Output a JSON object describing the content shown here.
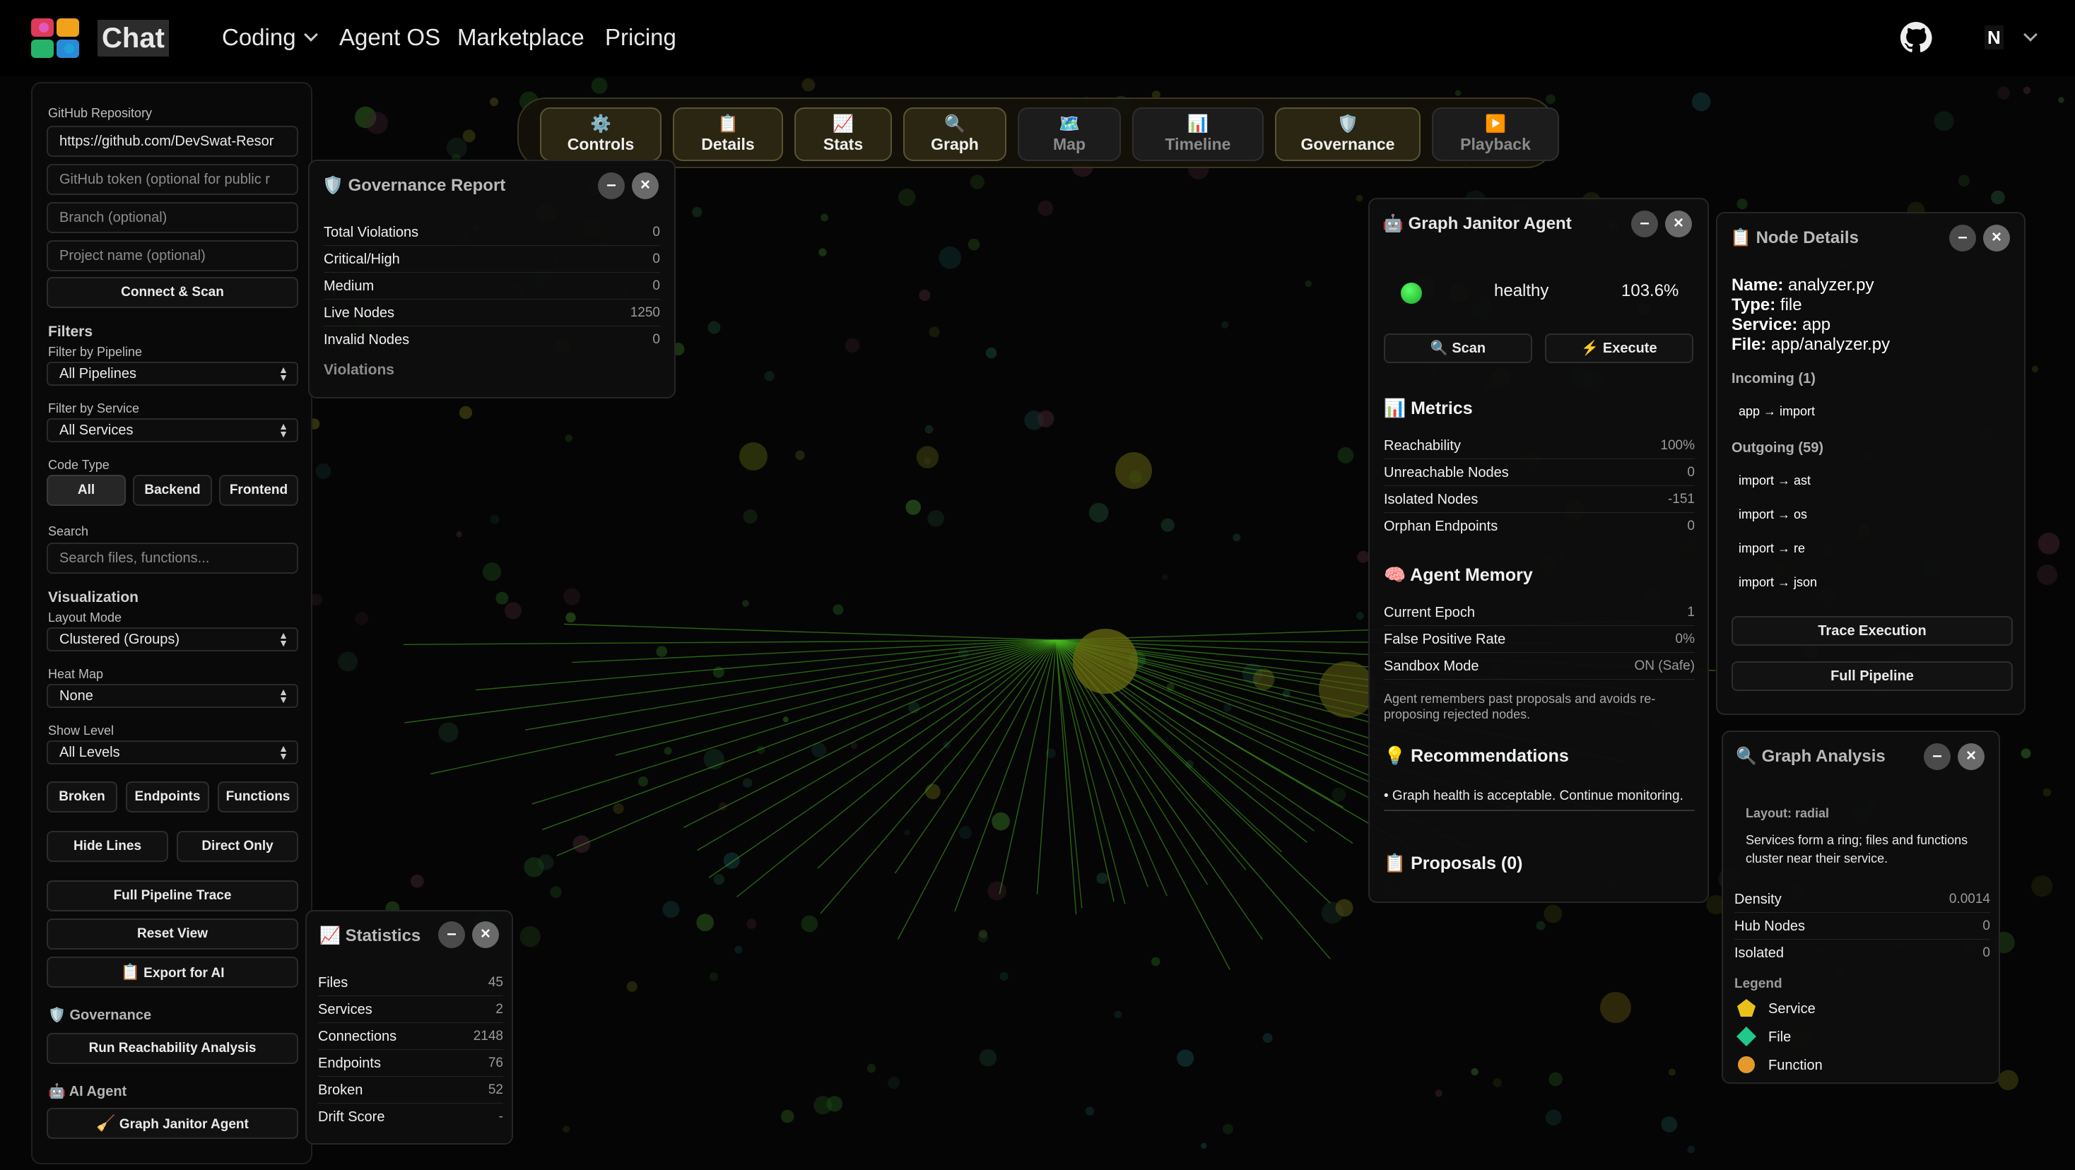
{
  "nav": {
    "app_title": "Chat",
    "links": [
      "Coding",
      "Agent OS",
      "Marketplace",
      "Pricing"
    ],
    "user_initial": "N"
  },
  "sidebar": {
    "repo_label": "GitHub Repository",
    "repo_value": "https://github.com/DevSwat-Resor",
    "token_placeholder": "GitHub token (optional for public r",
    "branch_placeholder": "Branch (optional)",
    "project_placeholder": "Project name (optional)",
    "connect_button": "Connect & Scan",
    "filters_heading": "Filters",
    "pipeline_label": "Filter by Pipeline",
    "pipeline_value": "All Pipelines",
    "service_label": "Filter by Service",
    "service_value": "All Services",
    "code_type_label": "Code Type",
    "code_types": [
      "All",
      "Backend",
      "Frontend"
    ],
    "search_label": "Search",
    "search_placeholder": "Search files, functions...",
    "viz_heading": "Visualization",
    "layout_label": "Layout Mode",
    "layout_value": "Clustered (Groups)",
    "heatmap_label": "Heat Map",
    "heatmap_value": "None",
    "level_label": "Show Level",
    "level_value": "All Levels",
    "toggles": [
      "Broken",
      "Endpoints",
      "Functions"
    ],
    "line_buttons": [
      "Hide Lines",
      "Direct Only"
    ],
    "full_trace": "Full Pipeline Trace",
    "reset_view": "Reset View",
    "export_ai": "Export for AI",
    "governance_heading": "Governance",
    "reachability_button": "Run Reachability Analysis",
    "ai_agent_heading": "AI Agent",
    "janitor_button": "Graph Janitor Agent"
  },
  "toolbar": {
    "buttons": [
      {
        "label": "Controls",
        "icon": "gear-icon"
      },
      {
        "label": "Details",
        "icon": "clipboard-icon"
      },
      {
        "label": "Stats",
        "icon": "chart-icon"
      },
      {
        "label": "Graph",
        "icon": "magnifier-icon"
      },
      {
        "label": "Map",
        "icon": "map-icon"
      },
      {
        "label": "Timeline",
        "icon": "bar-chart-icon"
      },
      {
        "label": "Governance",
        "icon": "shield-icon"
      },
      {
        "label": "Playback",
        "icon": "play-icon"
      }
    ]
  },
  "governance": {
    "title": "Governance Report",
    "rows": [
      {
        "label": "Total Violations",
        "value": "0"
      },
      {
        "label": "Critical/High",
        "value": "0"
      },
      {
        "label": "Medium",
        "value": "0"
      },
      {
        "label": "Live Nodes",
        "value": "1250"
      },
      {
        "label": "Invalid Nodes",
        "value": "0"
      }
    ],
    "violations_label": "Violations"
  },
  "statistics": {
    "title": "Statistics",
    "rows": [
      {
        "label": "Files",
        "value": "45"
      },
      {
        "label": "Services",
        "value": "2"
      },
      {
        "label": "Connections",
        "value": "2148"
      },
      {
        "label": "Endpoints",
        "value": "76"
      },
      {
        "label": "Broken",
        "value": "52"
      },
      {
        "label": "Drift Score",
        "value": "-"
      }
    ]
  },
  "janitor": {
    "title": "Graph Janitor Agent",
    "status": "healthy",
    "health_pct": "103.6%",
    "scan_button": "Scan",
    "execute_button": "Execute",
    "metrics_heading": "Metrics",
    "metrics": [
      {
        "label": "Reachability",
        "value": "100%"
      },
      {
        "label": "Unreachable Nodes",
        "value": "0"
      },
      {
        "label": "Isolated Nodes",
        "value": "-151"
      },
      {
        "label": "Orphan Endpoints",
        "value": "0"
      }
    ],
    "memory_heading": "Agent Memory",
    "memory": [
      {
        "label": "Current Epoch",
        "value": "1"
      },
      {
        "label": "False Positive Rate",
        "value": "0%"
      },
      {
        "label": "Sandbox Mode",
        "value": "ON (Safe)"
      }
    ],
    "memory_note": "Agent remembers past proposals and avoids re-proposing rejected nodes.",
    "recommendations_heading": "Recommendations",
    "recommendation": "• Graph health is acceptable. Continue monitoring.",
    "proposals_heading": "Proposals (0)"
  },
  "node_details": {
    "title": "Node Details",
    "name_label": "Name:",
    "name_value": "analyzer.py",
    "type_label": "Type:",
    "type_value": "file",
    "service_label": "Service:",
    "service_value": "app",
    "file_label": "File:",
    "file_value": "app/analyzer.py",
    "incoming_heading": "Incoming (1)",
    "incoming": [
      "app → import"
    ],
    "outgoing_heading": "Outgoing (59)",
    "outgoing": [
      "import → ast",
      "import → os",
      "import → re",
      "import → json"
    ],
    "trace_button": "Trace Execution",
    "pipeline_button": "Full Pipeline"
  },
  "analysis": {
    "title": "Graph Analysis",
    "layout_line": "Layout: radial",
    "description": "Services form a ring; files and functions cluster near their service.",
    "rows": [
      {
        "label": "Density",
        "value": "0.0014"
      },
      {
        "label": "Hub Nodes",
        "value": "0"
      },
      {
        "label": "Isolated",
        "value": "0"
      }
    ],
    "legend_heading": "Legend",
    "legend": [
      {
        "label": "Service",
        "color": "#e8c21a"
      },
      {
        "label": "File",
        "color": "#1fc98a"
      },
      {
        "label": "Function",
        "color": "#e39a2a"
      }
    ]
  }
}
